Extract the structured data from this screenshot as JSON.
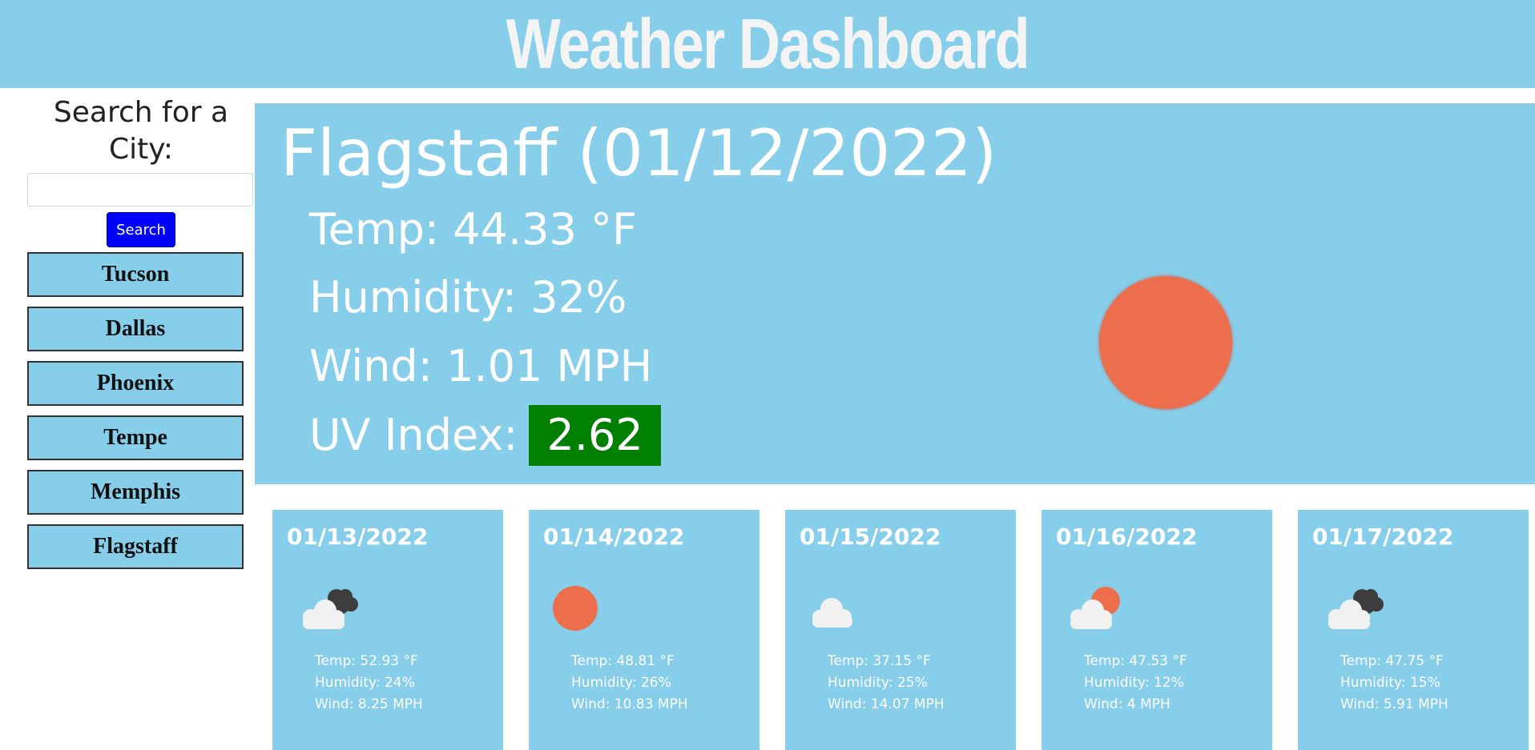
{
  "header": {
    "title": "Weather Dashboard"
  },
  "sidebar": {
    "search_title": "Search for a City:",
    "search_placeholder": "",
    "search_button": "Search",
    "history": [
      "Tucson",
      "Dallas",
      "Phoenix",
      "Tempe",
      "Memphis",
      "Flagstaff"
    ]
  },
  "current": {
    "title": "Flagstaff (01/12/2022)",
    "temp": "Temp: 44.33 °F",
    "humidity": "Humidity: 32%",
    "wind": "Wind: 1.01 MPH",
    "uv_label": "UV Index:",
    "uv_value": "2.62",
    "uv_color": "#008000",
    "icon": "sun-icon"
  },
  "forecast": [
    {
      "date": "01/13/2022",
      "icon": "cloudy-icon",
      "temp": "Temp: 52.93 °F",
      "humidity": "Humidity: 24%",
      "wind": "Wind: 8.25 MPH"
    },
    {
      "date": "01/14/2022",
      "icon": "sun-icon",
      "temp": "Temp: 48.81 °F",
      "humidity": "Humidity: 26%",
      "wind": "Wind: 10.83 MPH"
    },
    {
      "date": "01/15/2022",
      "icon": "cloud-icon",
      "temp": "Temp: 37.15 °F",
      "humidity": "Humidity: 25%",
      "wind": "Wind: 14.07 MPH"
    },
    {
      "date": "01/16/2022",
      "icon": "partly-cloudy-icon",
      "temp": "Temp: 47.53 °F",
      "humidity": "Humidity: 12%",
      "wind": "Wind: 4 MPH"
    },
    {
      "date": "01/17/2022",
      "icon": "cloudy-icon",
      "temp": "Temp: 47.75 °F",
      "humidity": "Humidity: 15%",
      "wind": "Wind: 5.91 MPH"
    }
  ],
  "colors": {
    "accent": "#87ceeb",
    "search_button": "#0000ff",
    "sun": "#ec6e4c"
  }
}
